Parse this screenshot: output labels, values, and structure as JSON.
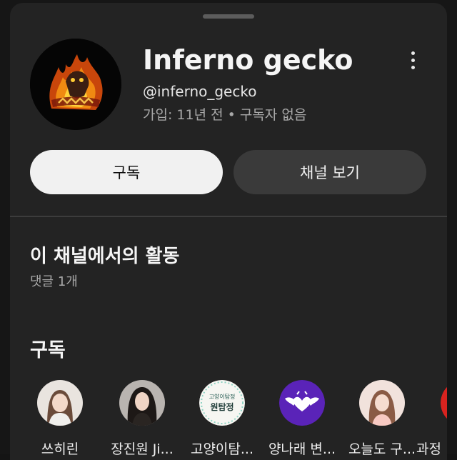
{
  "channel": {
    "name": "Inferno gecko",
    "handle": "@inferno_gecko",
    "meta": "가입: 11년 전 • 구독자 없음",
    "avatar_icon": "flame-gecko-logo"
  },
  "actions": {
    "subscribe_label": "구독",
    "view_channel_label": "채널 보기"
  },
  "activity": {
    "title": "이 채널에서의 활동",
    "summary": "댓글 1개"
  },
  "subscriptions": {
    "title": "구독",
    "items": [
      {
        "label": "쓰히린",
        "avatar_icon": "profile-photo-icon"
      },
      {
        "label": "장진원 Ji...",
        "avatar_icon": "profile-photo-icon"
      },
      {
        "label": "고양이탐...",
        "avatar_icon": "text-logo-icon",
        "logo_text_top": "고양이탐정",
        "logo_text_main": "원탐정"
      },
      {
        "label": "양나래 변...",
        "avatar_icon": "heart-wings-icon"
      },
      {
        "label": "오늘도 구...",
        "avatar_icon": "profile-photo-icon"
      },
      {
        "label": "과정",
        "avatar_icon": "red-logo-icon"
      }
    ]
  },
  "colors": {
    "sheet_bg": "#232323",
    "subscribe_bg": "#f1f1f1",
    "view_bg": "#3a3a3a",
    "purple_avatar": "#5a23b8"
  }
}
